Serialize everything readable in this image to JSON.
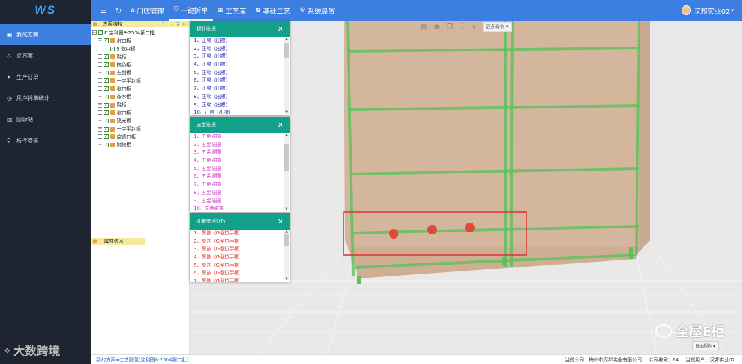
{
  "app": {
    "logo": "WS"
  },
  "nav": {
    "menu_icon": "menu-icon",
    "refresh_icon": "refresh-icon",
    "items": [
      {
        "label": "门店管理",
        "icon": "home-icon"
      },
      {
        "label": "一键拆单",
        "icon": "shield-icon"
      },
      {
        "label": "工艺库",
        "icon": "grid-icon"
      },
      {
        "label": "基础工艺",
        "icon": "palette-icon"
      },
      {
        "label": "系统设置",
        "icon": "gear-icon"
      }
    ],
    "active_index": 1
  },
  "user": {
    "name": "汉邦实业02"
  },
  "sidebar": {
    "items": [
      {
        "label": "我的方案",
        "icon": "folder-icon"
      },
      {
        "label": "总方案",
        "icon": "diamond-icon"
      },
      {
        "label": "生产订单",
        "icon": "send-icon"
      },
      {
        "label": "用户拆单统计",
        "icon": "clock-icon"
      },
      {
        "label": "回收站",
        "icon": "trash-icon"
      },
      {
        "label": "板件查询",
        "icon": "search-icon"
      }
    ],
    "active_index": 0
  },
  "tree": {
    "title": "方案结构",
    "root": "宝利园8-2504第二批",
    "nodes": [
      {
        "level": 1,
        "label": "收口板",
        "expanded": true
      },
      {
        "level": 2,
        "label": "收口板"
      },
      {
        "level": 1,
        "label": "鞋柜"
      },
      {
        "level": 1,
        "label": "梳妆柜"
      },
      {
        "level": 1,
        "label": "左封板"
      },
      {
        "level": 1,
        "label": "一字平封板"
      },
      {
        "level": 1,
        "label": "收口板"
      },
      {
        "level": 1,
        "label": "茶水柜"
      },
      {
        "level": 1,
        "label": "鞋柜"
      },
      {
        "level": 1,
        "label": "收口板"
      },
      {
        "level": 1,
        "label": "见光板"
      },
      {
        "level": 1,
        "label": "一字平封板"
      },
      {
        "level": 1,
        "label": "空调口柜"
      },
      {
        "level": 1,
        "label": "储物柜"
      }
    ],
    "props_title": "属性信息"
  },
  "dialogs": [
    {
      "title": "板件碰撞",
      "color": "#2a2aa8",
      "rows": [
        "1、正常（出槽）",
        "2、正常（出槽）",
        "3、正常（出槽）",
        "4、正常（出槽）",
        "5、正常（出槽）",
        "6、正常（出槽）",
        "7、正常（出槽）",
        "8、正常（出槽）",
        "9、正常（出槽）",
        "10、正常（出槽）"
      ]
    },
    {
      "title": "五金碰撞",
      "color": "#d030c8",
      "rows": [
        "1、五金碰撞",
        "2、五金碰撞",
        "3、五金碰撞",
        "4、五金碰撞",
        "5、五金碰撞",
        "6、五金碰撞",
        "7、五金碰撞",
        "8、五金碰撞",
        "9、五金碰撞",
        "10、五金碰撞"
      ]
    },
    {
      "title": "孔槽错误分析",
      "color": "#e03a2a",
      "rows": [
        "1、警告（G型拉手槽）",
        "2、警告（G型拉手槽）",
        "3、警告（G型拉手槽）",
        "4、警告（G型拉手槽）",
        "5、警告（G型拉手槽）",
        "6、警告（G型拉手槽）",
        "7、警告（G型拉手槽）"
      ]
    }
  ],
  "viewport": {
    "more_ops": "更多操作",
    "view_angle": "自由视角",
    "watermark": "全屋E柜",
    "tool_icons": [
      "box-icon",
      "target-icon",
      "copy-icon",
      "fullscreen-icon",
      "flash-icon"
    ]
  },
  "brand": {
    "label": "大数跨境"
  },
  "footer": {
    "breadcrumb": "我的方案➜工艺配置[宝利园8-2504第二批]",
    "company": "当前公司：梅州市汉邦实业有限公司",
    "company_no": "公司编号：64",
    "current_user": "当前用户：汉邦实业02"
  }
}
